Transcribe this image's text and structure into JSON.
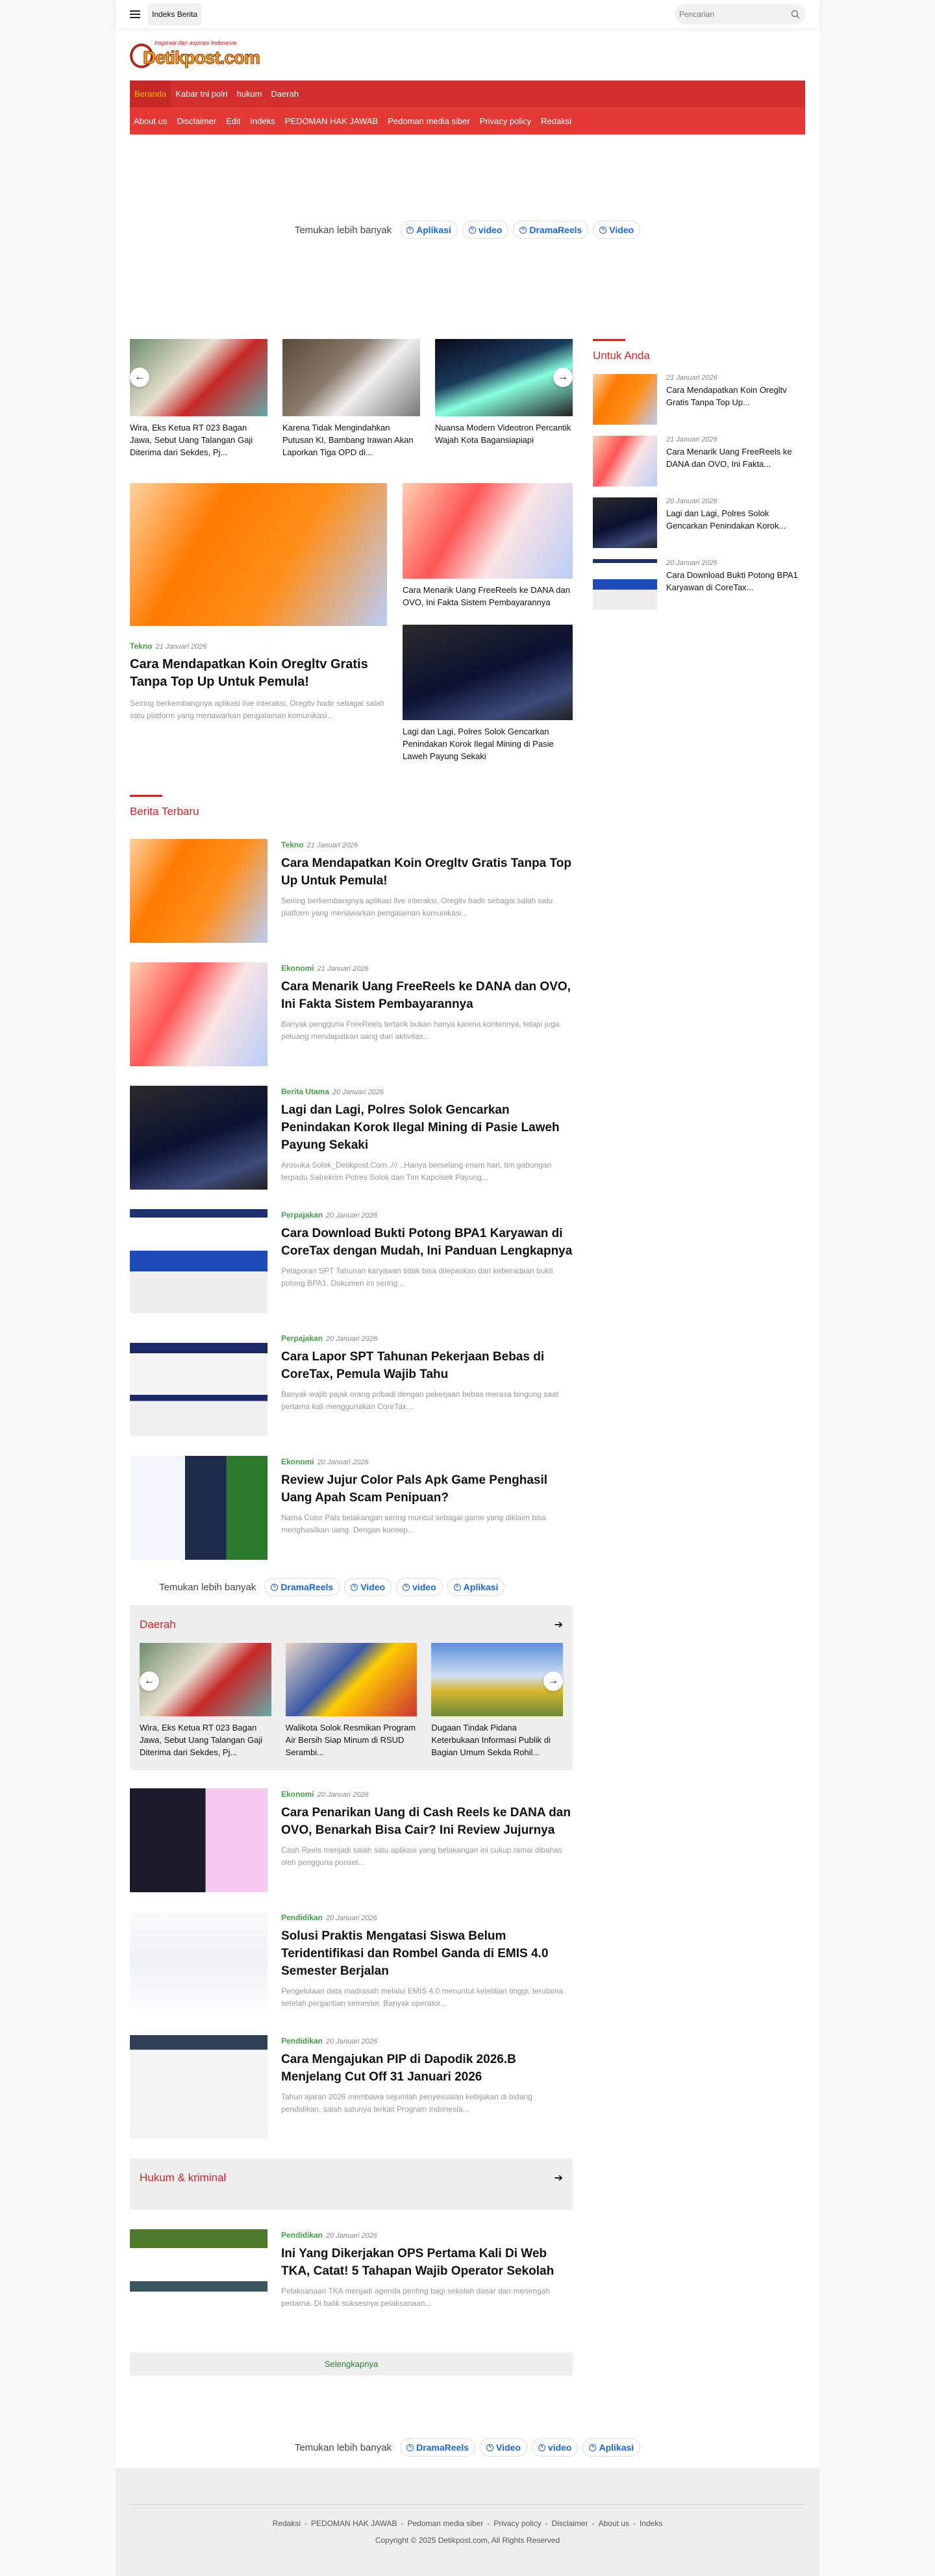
{
  "header": {
    "indeks_label": "Indeks Berita",
    "search_placeholder": "Pencarian"
  },
  "logo": {
    "tagline": "Inspirasi dan aspirasi Indonesia",
    "name": "Detikpost.com"
  },
  "nav": {
    "primary": [
      "Beranda",
      "Kabar tni polri",
      "hukum",
      "Daerah"
    ],
    "secondary": [
      "About us",
      "Disclaimer",
      "Edit",
      "Indeks",
      "PEDOMAN HAK JAWAB",
      "Pedoman media siber",
      "Privacy policy",
      "Redaksi"
    ]
  },
  "discover": {
    "label": "Temukan lebih banyak",
    "top": [
      "Aplikasi",
      "video",
      "DramaReels",
      "Video"
    ],
    "middle": [
      "DramaReels",
      "Video",
      "video",
      "Aplikasi"
    ],
    "bottom": [
      "DramaReels",
      "Video",
      "video",
      "Aplikasi"
    ]
  },
  "slider": [
    {
      "title": "Wira, Eks Ketua RT 023 Bagan Jawa, Sebut Uang Talangan Gaji Diterima dari Sekdes, Pj..."
    },
    {
      "title": "Karena Tidak Mengindahkan Putusan KI, Bambang Irawan Akan Laporkan Tiga OPD di..."
    },
    {
      "title": "Nuansa Modern Videotron Percantik Wajah Kota Bagansiapiapi"
    }
  ],
  "featured": {
    "main": {
      "category": "Tekno",
      "date": "21 Januari 2026",
      "title": "Cara Mendapatkan Koin Oregltv Gratis Tanpa Top Up Untuk Pemula!",
      "excerpt": "Seiring berkembangnya aplikasi live interaksi, Oregltv hadir sebagai salah satu platform yang menawarkan pengalaman komunikasi..."
    },
    "side": [
      {
        "title": "Cara Menarik Uang FreeReels ke DANA dan OVO, Ini Fakta Sistem Pembayarannya"
      },
      {
        "title": "Lagi dan Lagi, Polres Solok Gencarkan Penindakan Korok Ilegal Mining di Pasie Laweh Payung Sekaki"
      }
    ]
  },
  "sidebar": {
    "title": "Untuk Anda",
    "items": [
      {
        "date": "21 Januari 2026",
        "title": "Cara Mendapatkan Koin Oregltv Gratis Tanpa Top Up..."
      },
      {
        "date": "21 Januari 2026",
        "title": "Cara Menarik Uang FreeReels ke DANA dan OVO, Ini Fakta..."
      },
      {
        "date": "20 Januari 2026",
        "title": "Lagi dan Lagi, Polres Solok Gencarkan Penindakan Korok..."
      },
      {
        "date": "20 Januari 2026",
        "title": "Cara Download Bukti Potong BPA1 Karyawan di CoreTax..."
      }
    ]
  },
  "latest": {
    "title": "Berita Terbaru",
    "items": [
      {
        "category": "Tekno",
        "date": "21 Januari 2026",
        "title": "Cara Mendapatkan Koin Oregltv Gratis Tanpa Top Up Untuk Pemula!",
        "excerpt": "Seiring berkembangnya aplikasi live interaksi, Oregltv hadir sebagai salah satu platform yang menawarkan pengalaman komunikasi..."
      },
      {
        "category": "Ekonomi",
        "date": "21 Januari 2026",
        "title": "Cara Menarik Uang FreeReels ke DANA dan OVO, Ini Fakta Sistem Pembayarannya",
        "excerpt": "Banyak pengguna FreeReels tertarik bukan hanya karena kontennya, tetapi juga peluang mendapatkan uang dari aktivitas..."
      },
      {
        "category": "Berita Utama",
        "date": "20 Januari 2026",
        "title": "Lagi dan Lagi, Polres Solok Gencarkan Penindakan Korok Ilegal Mining di Pasie Laweh Payung Sekaki",
        "excerpt": "Arosuka Solok_Detikpost.Com../// ..Hanya berselang enam hari, tim gabungan terpadu Satrekrim Polres Solok dan Tim Kapolsek Payung..."
      },
      {
        "category": "Perpajakan",
        "date": "20 Januari 2026",
        "title": "Cara Download Bukti Potong BPA1 Karyawan di CoreTax dengan Mudah, Ini Panduan Lengkapnya",
        "excerpt": "Pelaporan SPT Tahunan karyawan tidak bisa dilepaskan dari keberadaan bukti potong BPA1. Dokumen ini sering..."
      },
      {
        "category": "Perpajakan",
        "date": "20 Januari 2026",
        "title": "Cara Lapor SPT Tahunan Pekerjaan Bebas di CoreTax, Pemula Wajib Tahu",
        "excerpt": "Banyak wajib pajak orang pribadi dengan pekerjaan bebas merasa bingung saat pertama kali menggunakan CoreTax..."
      },
      {
        "category": "Ekonomi",
        "date": "20 Januari 2026",
        "title": "Review Jujur Color Pals Apk Game Penghasil Uang Apah Scam Penipuan?",
        "excerpt": "Nama Color Pals belakangan sering muncul sebagai game yang diklaim bisa menghasilkan uang. Dengan konsep..."
      }
    ]
  },
  "daerah": {
    "title": "Daerah",
    "items": [
      {
        "title": "Wira, Eks Ketua RT 023 Bagan Jawa, Sebut Uang Talangan Gaji Diterima dari Sekdes, Pj..."
      },
      {
        "title": "Walikota Solok Resmikan Program Air Bersih Siap Minum di RSUD Serambi..."
      },
      {
        "title": "Dugaan Tindak Pidana Keterbukaan Informasi Publik di Bagian Umum Sekda Rohil..."
      }
    ]
  },
  "latest2": {
    "items": [
      {
        "category": "Ekonomi",
        "date": "20 Januari 2026",
        "title": "Cara Penarikan Uang di Cash Reels ke DANA dan OVO, Benarkah Bisa Cair? Ini Review Jujurnya",
        "excerpt": "Cash Reels menjadi salah satu aplikasi yang belakangan ini cukup ramai dibahas oleh pengguna ponsel..."
      },
      {
        "category": "Pendidikan",
        "date": "20 Januari 2026",
        "title": "Solusi Praktis Mengatasi Siswa Belum Teridentifikasi dan Rombel Ganda di EMIS 4.0 Semester Berjalan",
        "excerpt": "Pengelolaan data madrasah melalui EMIS 4.0 menuntut ketelitian tinggi, terutama setelah pergantian semester. Banyak operator..."
      },
      {
        "category": "Pendidikan",
        "date": "20 Januari 2026",
        "title": "Cara Mengajukan PIP di Dapodik 2026.B Menjelang Cut Off 31 Januari 2026",
        "excerpt": "Tahun ajaran 2026 membawa sejumlah penyesuaian kebijakan di bidang pendidikan, salah satunya terkait Program Indonesia..."
      }
    ]
  },
  "hukum": {
    "title": "Hukum & kriminal",
    "items": [
      {
        "category": "Pendidikan",
        "date": "20 Januari 2026",
        "title": "Ini Yang Dikerjakan OPS Pertama Kali Di Web TKA, Catat! 5 Tahapan Wajib Operator Sekolah",
        "excerpt": "Pelaksanaan TKA menjadi agenda penting bagi sekolah dasar dan menengah pertama. Di balik suksesnya pelaksanaan..."
      }
    ]
  },
  "load_more": "Selengkapnya",
  "footer": {
    "links": [
      "Redaksi",
      "PEDOMAN HAK JAWAB",
      "Pedoman media siber",
      "Privacy policy",
      "Disclaimer",
      "About us",
      "Indeks"
    ],
    "separator": "-",
    "copyright": "Copyright © 2025 Detikpost.com, All Rights Reserved"
  }
}
